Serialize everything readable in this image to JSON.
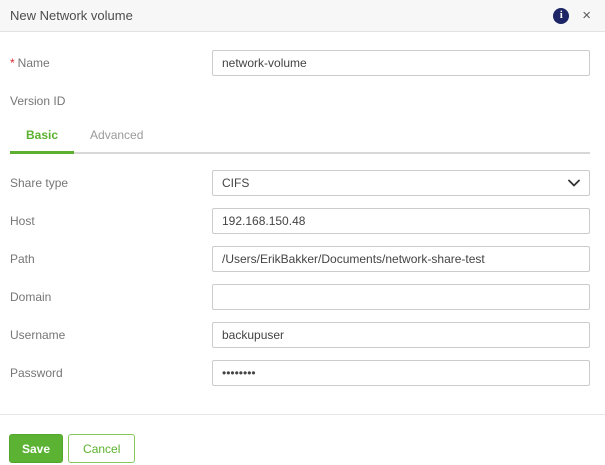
{
  "dialog": {
    "title": "New Network volume",
    "info_icon_glyph": "i",
    "close_icon_glyph": "×"
  },
  "form": {
    "fields": {
      "name": {
        "label": "Name",
        "required_mark": "*",
        "value": "network-volume"
      },
      "version_id": {
        "label": "Version ID"
      },
      "share_type": {
        "label": "Share type",
        "value": "CIFS"
      },
      "host": {
        "label": "Host",
        "value": "192.168.150.48"
      },
      "path": {
        "label": "Path",
        "value": "/Users/ErikBakker/Documents/network-share-test"
      },
      "domain": {
        "label": "Domain",
        "value": ""
      },
      "username": {
        "label": "Username",
        "value": "backupuser"
      },
      "password": {
        "label": "Password",
        "value": "••••••••"
      }
    },
    "tabs": [
      {
        "label": "Basic"
      },
      {
        "label": "Advanced"
      }
    ]
  },
  "footer": {
    "save_label": "Save",
    "cancel_label": "Cancel"
  },
  "colors": {
    "accent_green": "#5bb12f",
    "info_navy": "#1d2567",
    "required_red": "#d7282f",
    "header_bg": "#f7f7f7",
    "input_border": "#cccccc"
  }
}
